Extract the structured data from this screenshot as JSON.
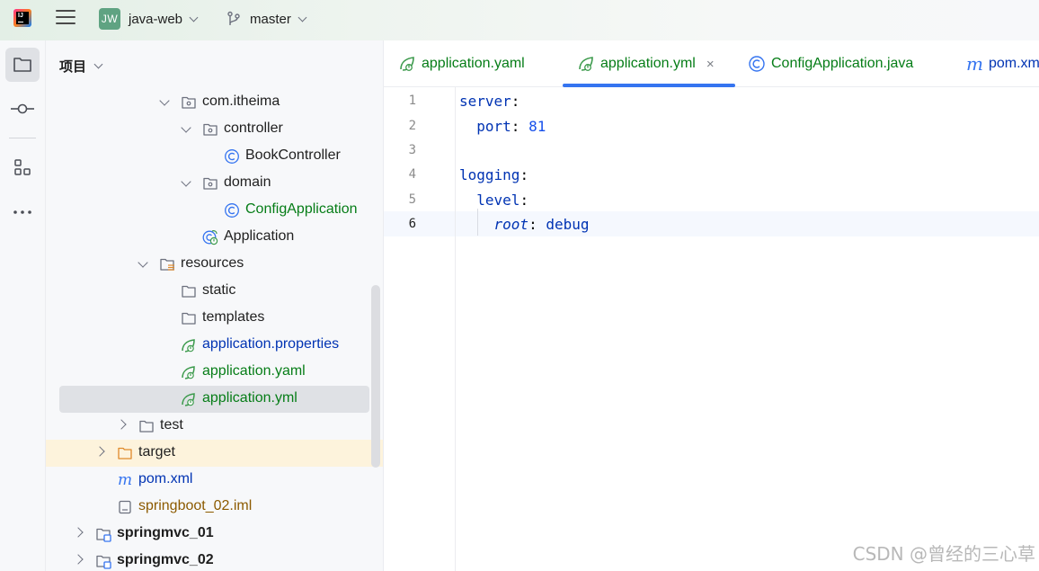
{
  "titlebar": {
    "logo_text": "IJ",
    "project_badge": "JW",
    "project_name": "java-web",
    "branch_name": "master"
  },
  "project_panel": {
    "header": "项目",
    "rows": [
      {
        "label": "com.itheima",
        "kind": "package",
        "color": "#1f1f1f"
      },
      {
        "label": "controller",
        "kind": "package",
        "color": "#1f1f1f"
      },
      {
        "label": "BookController",
        "kind": "class",
        "color": "#1f1f1f"
      },
      {
        "label": "domain",
        "kind": "package",
        "color": "#1f1f1f"
      },
      {
        "label": "ConfigApplication",
        "kind": "class",
        "color": "#067d17"
      },
      {
        "label": "Application",
        "kind": "spring-class",
        "color": "#1f1f1f"
      },
      {
        "label": "resources",
        "kind": "resources-folder",
        "color": "#1f1f1f"
      },
      {
        "label": "static",
        "kind": "folder",
        "color": "#1f1f1f"
      },
      {
        "label": "templates",
        "kind": "folder",
        "color": "#1f1f1f"
      },
      {
        "label": "application.properties",
        "kind": "spring-config",
        "color": "#0033b3"
      },
      {
        "label": "application.yaml",
        "kind": "spring-config",
        "color": "#067d17"
      },
      {
        "label": "application.yml",
        "kind": "spring-config",
        "color": "#067d17"
      },
      {
        "label": "test",
        "kind": "folder",
        "color": "#1f1f1f"
      },
      {
        "label": "target",
        "kind": "excluded-folder",
        "color": "#1f1f1f"
      },
      {
        "label": "pom.xml",
        "kind": "maven",
        "color": "#0033b3"
      },
      {
        "label": "springboot_02.iml",
        "kind": "iml",
        "color": "#8c5a00"
      },
      {
        "label": "springmvc_01",
        "kind": "module",
        "color": "#1f1f1f"
      },
      {
        "label": "springmvc_02",
        "kind": "module",
        "color": "#1f1f1f"
      }
    ]
  },
  "editor": {
    "tabs": [
      {
        "label": "application.yaml",
        "icon": "spring-config-icon",
        "active": false
      },
      {
        "label": "application.yml",
        "icon": "spring-config-icon",
        "active": true,
        "close": "×"
      },
      {
        "label": "ConfigApplication.java",
        "icon": "class-icon",
        "active": false
      },
      {
        "label": "pom.xml",
        "icon": "maven-icon",
        "active": false
      }
    ],
    "line_numbers": [
      "1",
      "2",
      "3",
      "4",
      "5",
      "6"
    ],
    "current_line": "6",
    "code": {
      "l1_key": "server",
      "l2_key": "port",
      "l2_val": "81",
      "l4_key": "logging",
      "l5_key": "level",
      "l6_key": "root",
      "l6_val": "debug",
      "colon": ":"
    }
  },
  "watermark": "CSDN @曾经的三心草",
  "colors": {
    "accent": "#3574f0",
    "green": "#067d17",
    "blue": "#0033b3",
    "selection": "#dfe1e5",
    "excluded_bg": "#fdf3dc"
  }
}
